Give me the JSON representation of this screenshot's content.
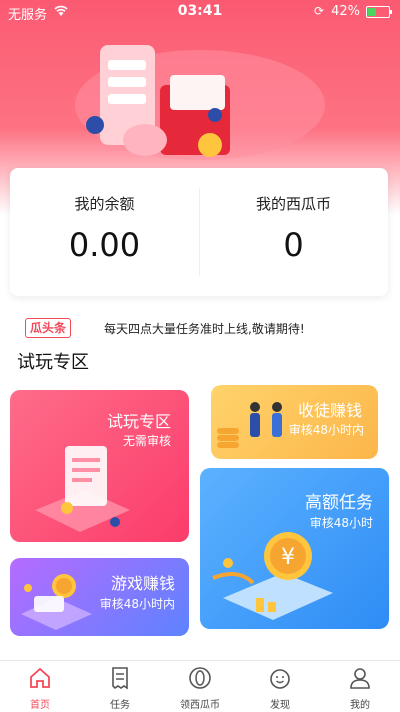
{
  "status_bar": {
    "carrier": "无服务",
    "time": "03:41",
    "battery": "42%"
  },
  "balance_card": {
    "balance_label": "我的余额",
    "balance_value": "0.00",
    "coins_label": "我的西瓜币",
    "coins_value": "0"
  },
  "news": {
    "badge": "瓜头条",
    "text": "每天四点大量任务准时上线,敬请期待!"
  },
  "section": {
    "title": "试玩专区"
  },
  "tiles": [
    {
      "title": "试玩专区",
      "subtitle": "无需审核"
    },
    {
      "title": "收徒赚钱",
      "subtitle": "审核48小时内"
    },
    {
      "title": "高额任务",
      "subtitle": "审核48小时"
    },
    {
      "title": "游戏赚钱",
      "subtitle": "审核48小时内"
    }
  ],
  "tabbar": {
    "items": [
      {
        "label": "首页"
      },
      {
        "label": "任务"
      },
      {
        "label": "领西瓜币"
      },
      {
        "label": "发现"
      },
      {
        "label": "我的"
      }
    ],
    "active_color": "#f24a5b"
  }
}
